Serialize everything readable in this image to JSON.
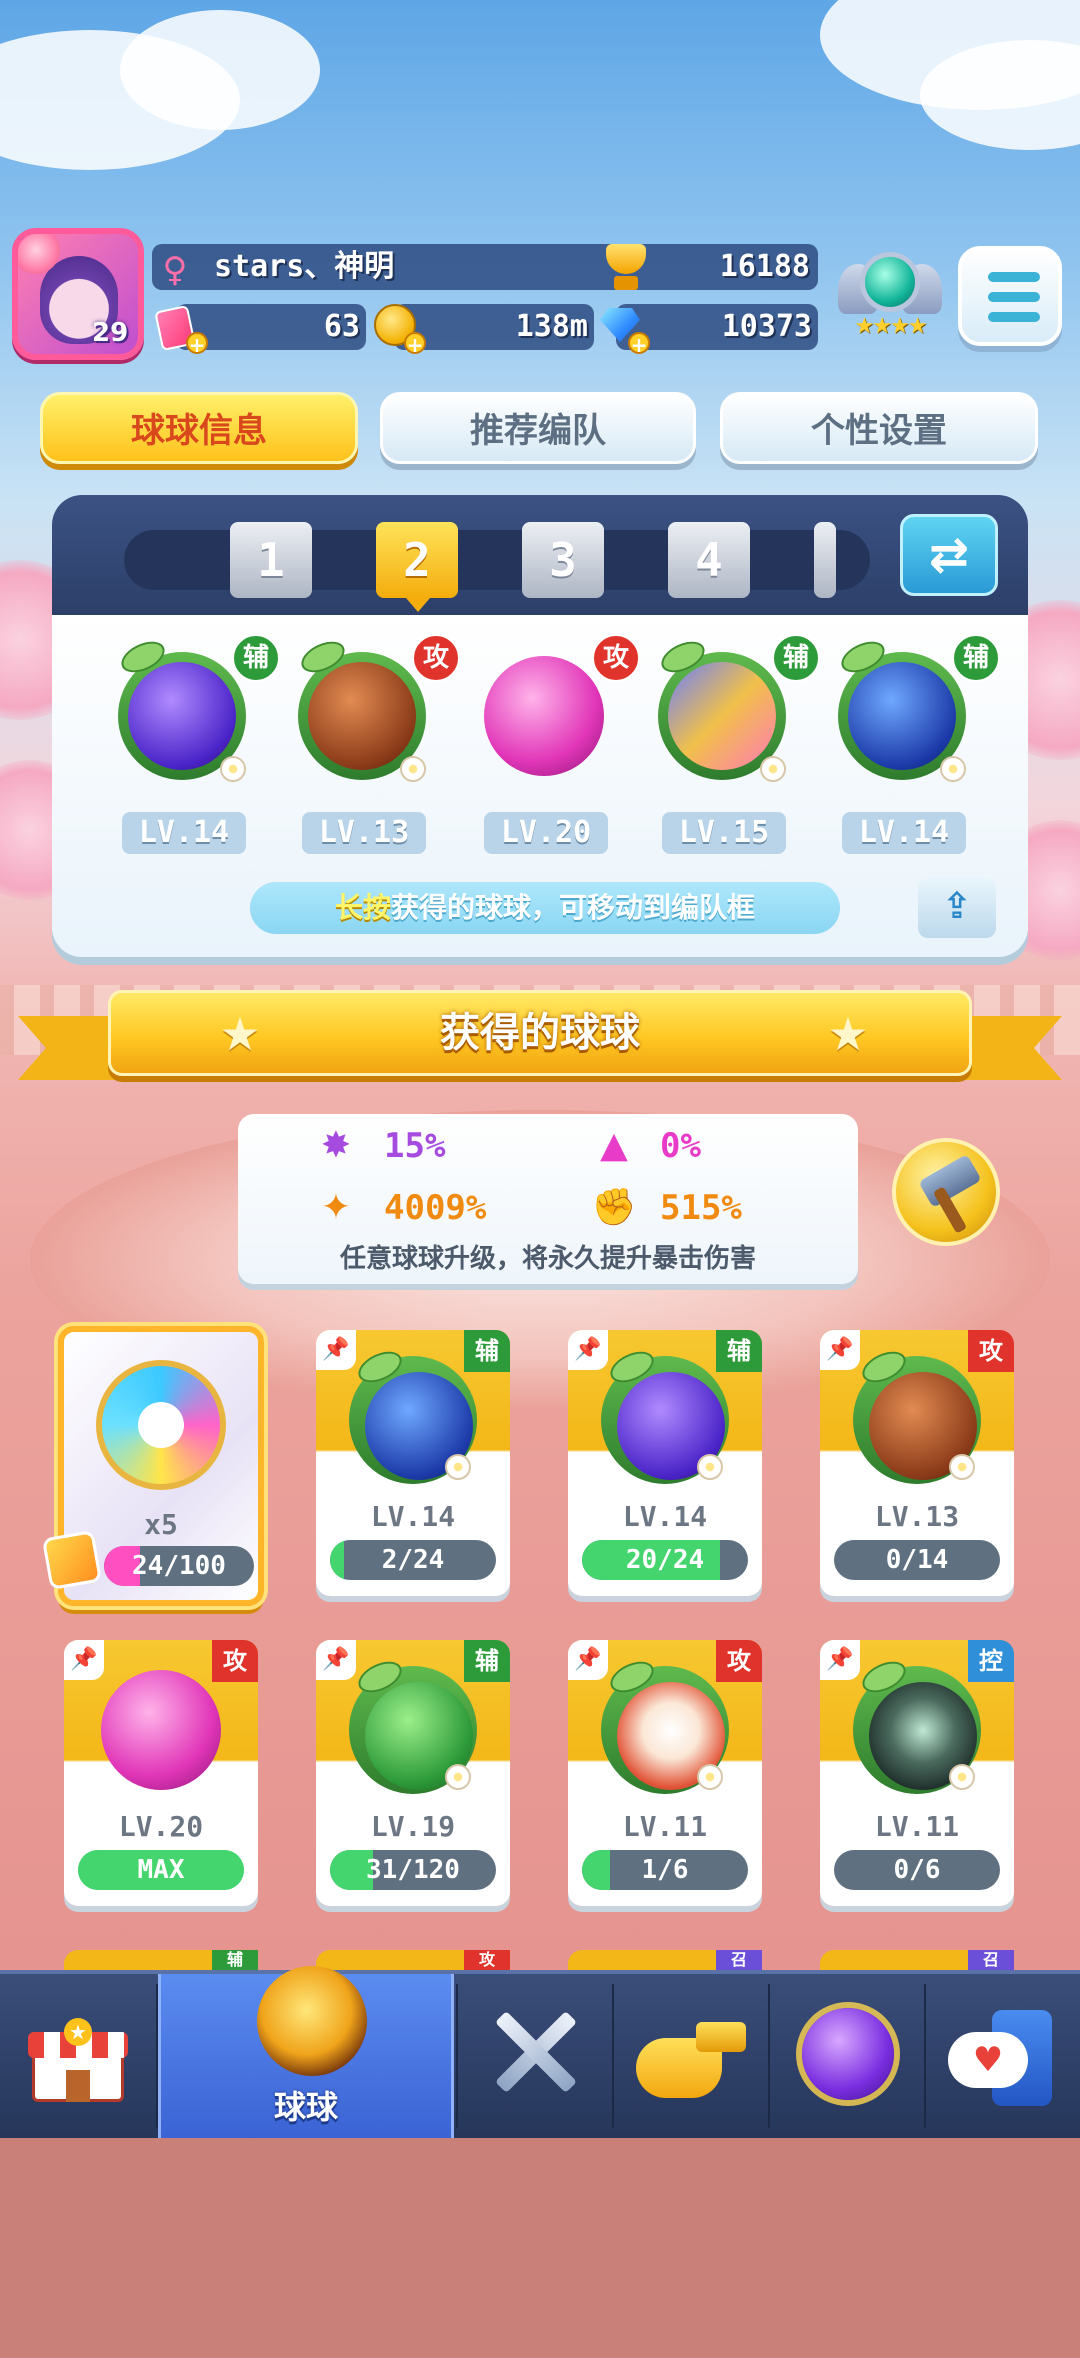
{
  "player": {
    "name": "stars、神明",
    "level": "29",
    "trophies": "16188",
    "cards": "63",
    "coins": "138m",
    "gems": "10373"
  },
  "tabs": [
    {
      "label": "球球信息",
      "active": true
    },
    {
      "label": "推荐编队",
      "active": false
    },
    {
      "label": "个性设置",
      "active": false
    }
  ],
  "team": {
    "slots": [
      "1",
      "2",
      "3",
      "4"
    ],
    "active_slot": "2",
    "balls": [
      {
        "name": "lightning-ball",
        "role": "辅",
        "level": "LV.14"
      },
      {
        "name": "infinity-ball",
        "role": "攻",
        "level": "LV.13"
      },
      {
        "name": "shield-ball",
        "role": "攻",
        "level": "LV.20"
      },
      {
        "name": "figures-ball",
        "role": "辅",
        "level": "LV.15"
      },
      {
        "name": "hexagon-ball",
        "role": "辅",
        "level": "LV.14"
      }
    ],
    "hint_highlight": "长按",
    "hint_text": "获得的球球，可移动到编队框"
  },
  "section_title": "获得的球球",
  "stats": {
    "crit_rate": "15%",
    "crit_up": "0%",
    "crit_damage": "4009%",
    "fist_damage": "515%",
    "note": "任意球球升级，将永久提升暴击伤害"
  },
  "special_card": {
    "count": "x5",
    "progress": "24/100",
    "progress_fraction": 0.24
  },
  "owned_balls": [
    {
      "name": "hexagon-ball",
      "role": "辅",
      "level": "LV.14",
      "progress": "2/24",
      "fraction": 0.083
    },
    {
      "name": "lightning-ball",
      "role": "辅",
      "level": "LV.14",
      "progress": "20/24",
      "fraction": 0.833
    },
    {
      "name": "infinity-ball",
      "role": "攻",
      "level": "LV.13",
      "progress": "0/14",
      "fraction": 0.0
    },
    {
      "name": "shield-ball",
      "role": "攻",
      "level": "LV.20",
      "progress": "MAX",
      "fraction": 1.0
    },
    {
      "name": "arrow-ball",
      "role": "辅",
      "level": "LV.19",
      "progress": "31/120",
      "fraction": 0.258
    },
    {
      "name": "fox-ball",
      "role": "攻",
      "level": "LV.11",
      "progress": "1/6",
      "fraction": 0.167
    },
    {
      "name": "crow-ball",
      "role": "控",
      "level": "LV.11",
      "progress": "0/6",
      "fraction": 0.0
    }
  ],
  "peek_roles": [
    "辅",
    "攻",
    "召",
    "召"
  ],
  "nav": [
    {
      "name": "shop",
      "label": ""
    },
    {
      "name": "balls",
      "label": "球球",
      "active": true
    },
    {
      "name": "battle",
      "label": ""
    },
    {
      "name": "whistle",
      "label": ""
    },
    {
      "name": "planet",
      "label": ""
    },
    {
      "name": "social",
      "label": ""
    }
  ],
  "colors": {
    "gold": "#f3b718",
    "assist": "#2e9b3a",
    "attack": "#e0332b",
    "control": "#2f8fd8",
    "summon": "#6b4fd8",
    "progress_green": "#45d56e",
    "progress_pink": "#ff4fc1"
  }
}
